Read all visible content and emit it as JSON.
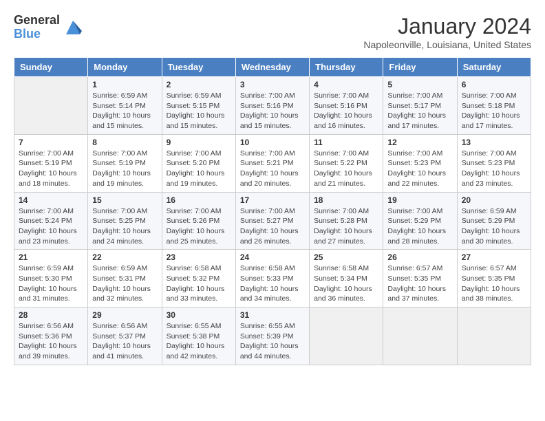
{
  "logo": {
    "general": "General",
    "blue": "Blue"
  },
  "header": {
    "month": "January 2024",
    "location": "Napoleonville, Louisiana, United States"
  },
  "weekdays": [
    "Sunday",
    "Monday",
    "Tuesday",
    "Wednesday",
    "Thursday",
    "Friday",
    "Saturday"
  ],
  "weeks": [
    [
      {
        "day": "",
        "info": ""
      },
      {
        "day": "1",
        "info": "Sunrise: 6:59 AM\nSunset: 5:14 PM\nDaylight: 10 hours\nand 15 minutes."
      },
      {
        "day": "2",
        "info": "Sunrise: 6:59 AM\nSunset: 5:15 PM\nDaylight: 10 hours\nand 15 minutes."
      },
      {
        "day": "3",
        "info": "Sunrise: 7:00 AM\nSunset: 5:16 PM\nDaylight: 10 hours\nand 15 minutes."
      },
      {
        "day": "4",
        "info": "Sunrise: 7:00 AM\nSunset: 5:16 PM\nDaylight: 10 hours\nand 16 minutes."
      },
      {
        "day": "5",
        "info": "Sunrise: 7:00 AM\nSunset: 5:17 PM\nDaylight: 10 hours\nand 17 minutes."
      },
      {
        "day": "6",
        "info": "Sunrise: 7:00 AM\nSunset: 5:18 PM\nDaylight: 10 hours\nand 17 minutes."
      }
    ],
    [
      {
        "day": "7",
        "info": "Sunrise: 7:00 AM\nSunset: 5:19 PM\nDaylight: 10 hours\nand 18 minutes."
      },
      {
        "day": "8",
        "info": "Sunrise: 7:00 AM\nSunset: 5:19 PM\nDaylight: 10 hours\nand 19 minutes."
      },
      {
        "day": "9",
        "info": "Sunrise: 7:00 AM\nSunset: 5:20 PM\nDaylight: 10 hours\nand 19 minutes."
      },
      {
        "day": "10",
        "info": "Sunrise: 7:00 AM\nSunset: 5:21 PM\nDaylight: 10 hours\nand 20 minutes."
      },
      {
        "day": "11",
        "info": "Sunrise: 7:00 AM\nSunset: 5:22 PM\nDaylight: 10 hours\nand 21 minutes."
      },
      {
        "day": "12",
        "info": "Sunrise: 7:00 AM\nSunset: 5:23 PM\nDaylight: 10 hours\nand 22 minutes."
      },
      {
        "day": "13",
        "info": "Sunrise: 7:00 AM\nSunset: 5:23 PM\nDaylight: 10 hours\nand 23 minutes."
      }
    ],
    [
      {
        "day": "14",
        "info": "Sunrise: 7:00 AM\nSunset: 5:24 PM\nDaylight: 10 hours\nand 23 minutes."
      },
      {
        "day": "15",
        "info": "Sunrise: 7:00 AM\nSunset: 5:25 PM\nDaylight: 10 hours\nand 24 minutes."
      },
      {
        "day": "16",
        "info": "Sunrise: 7:00 AM\nSunset: 5:26 PM\nDaylight: 10 hours\nand 25 minutes."
      },
      {
        "day": "17",
        "info": "Sunrise: 7:00 AM\nSunset: 5:27 PM\nDaylight: 10 hours\nand 26 minutes."
      },
      {
        "day": "18",
        "info": "Sunrise: 7:00 AM\nSunset: 5:28 PM\nDaylight: 10 hours\nand 27 minutes."
      },
      {
        "day": "19",
        "info": "Sunrise: 7:00 AM\nSunset: 5:29 PM\nDaylight: 10 hours\nand 28 minutes."
      },
      {
        "day": "20",
        "info": "Sunrise: 6:59 AM\nSunset: 5:29 PM\nDaylight: 10 hours\nand 30 minutes."
      }
    ],
    [
      {
        "day": "21",
        "info": "Sunrise: 6:59 AM\nSunset: 5:30 PM\nDaylight: 10 hours\nand 31 minutes."
      },
      {
        "day": "22",
        "info": "Sunrise: 6:59 AM\nSunset: 5:31 PM\nDaylight: 10 hours\nand 32 minutes."
      },
      {
        "day": "23",
        "info": "Sunrise: 6:58 AM\nSunset: 5:32 PM\nDaylight: 10 hours\nand 33 minutes."
      },
      {
        "day": "24",
        "info": "Sunrise: 6:58 AM\nSunset: 5:33 PM\nDaylight: 10 hours\nand 34 minutes."
      },
      {
        "day": "25",
        "info": "Sunrise: 6:58 AM\nSunset: 5:34 PM\nDaylight: 10 hours\nand 36 minutes."
      },
      {
        "day": "26",
        "info": "Sunrise: 6:57 AM\nSunset: 5:35 PM\nDaylight: 10 hours\nand 37 minutes."
      },
      {
        "day": "27",
        "info": "Sunrise: 6:57 AM\nSunset: 5:35 PM\nDaylight: 10 hours\nand 38 minutes."
      }
    ],
    [
      {
        "day": "28",
        "info": "Sunrise: 6:56 AM\nSunset: 5:36 PM\nDaylight: 10 hours\nand 39 minutes."
      },
      {
        "day": "29",
        "info": "Sunrise: 6:56 AM\nSunset: 5:37 PM\nDaylight: 10 hours\nand 41 minutes."
      },
      {
        "day": "30",
        "info": "Sunrise: 6:55 AM\nSunset: 5:38 PM\nDaylight: 10 hours\nand 42 minutes."
      },
      {
        "day": "31",
        "info": "Sunrise: 6:55 AM\nSunset: 5:39 PM\nDaylight: 10 hours\nand 44 minutes."
      },
      {
        "day": "",
        "info": ""
      },
      {
        "day": "",
        "info": ""
      },
      {
        "day": "",
        "info": ""
      }
    ]
  ]
}
